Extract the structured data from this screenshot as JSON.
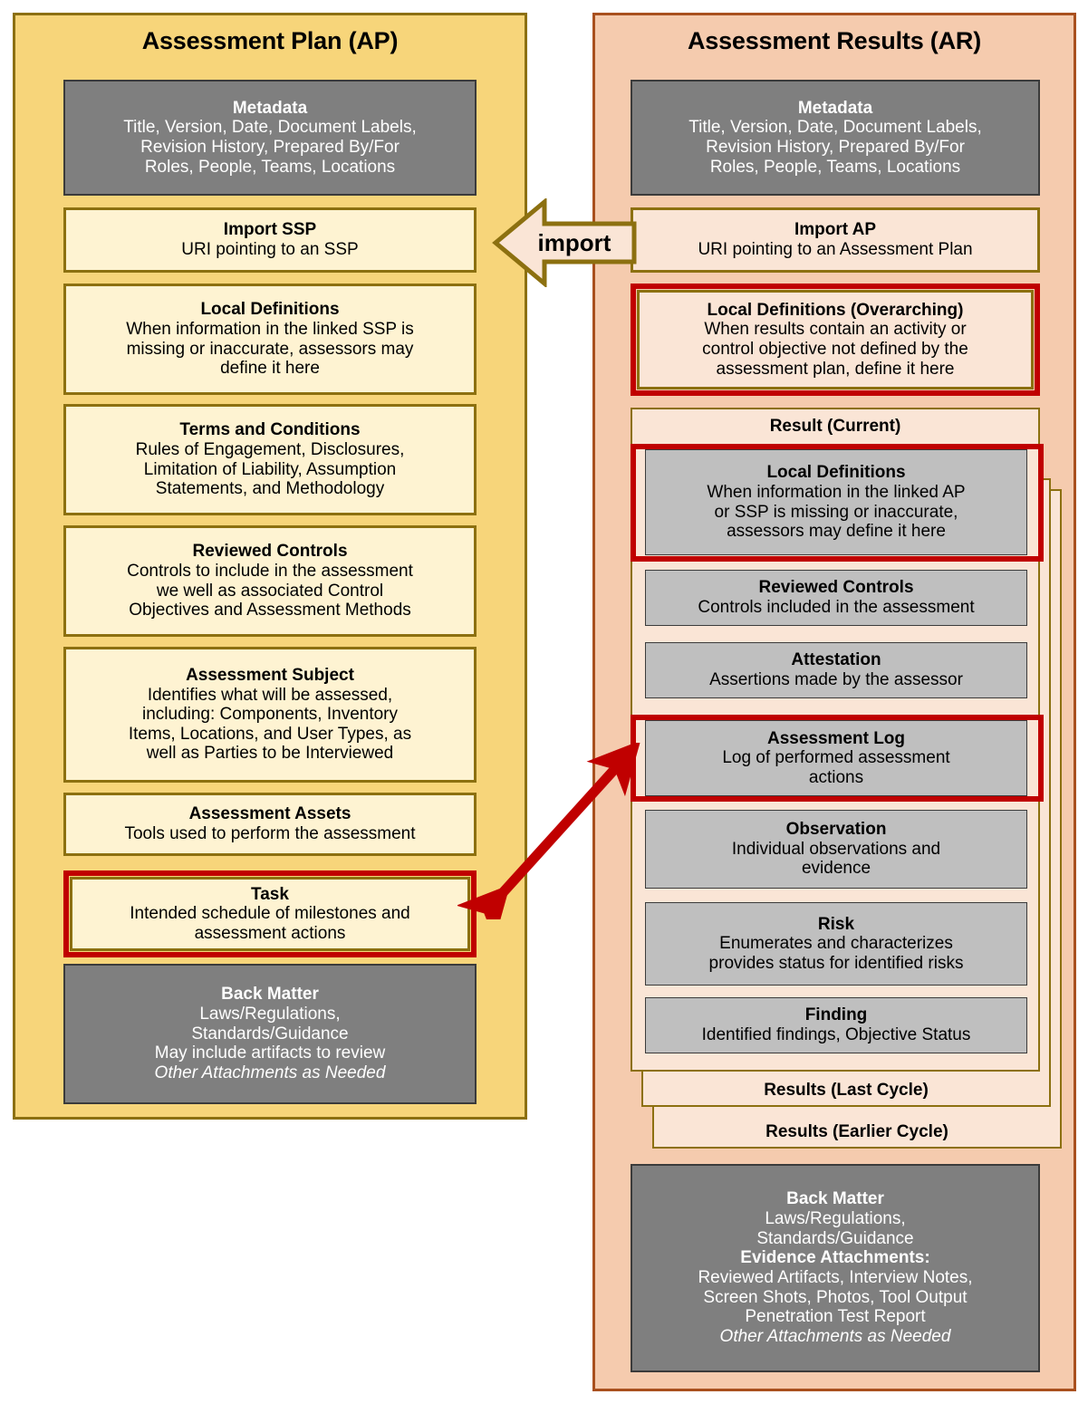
{
  "colors": {
    "ap_panel_fill": "#F7D57A",
    "ap_panel_border": "#8C7010",
    "ar_panel_fill": "#F5CBAE",
    "ar_panel_border": "#A9501E",
    "gray_box": "#7F7F7F",
    "gray_light_box": "#BFBFBF",
    "cream_box": "#FEF3D2",
    "peach_box": "#FAE5D6",
    "highlight_red": "#C00000"
  },
  "connector": {
    "import_label": "import",
    "red_double_arrow": "Task <-> Assessment Log"
  },
  "ap": {
    "title": "Assessment Plan (AP)",
    "boxes": [
      {
        "name": "metadata",
        "title": "Metadata",
        "lines": [
          "Title, Version, Date, Document Labels,",
          "Revision History, Prepared By/For",
          "Roles, People, Teams, Locations"
        ]
      },
      {
        "name": "import-ssp",
        "title": "Import SSP",
        "lines": [
          "URI pointing to an SSP"
        ]
      },
      {
        "name": "local-definitions",
        "title": "Local Definitions",
        "lines": [
          "When information in the linked SSP is",
          "missing or inaccurate, assessors may",
          "define it here"
        ]
      },
      {
        "name": "terms-and-conditions",
        "title": "Terms and Conditions",
        "lines": [
          "Rules of Engagement, Disclosures,",
          "Limitation of Liability, Assumption",
          "Statements, and Methodology"
        ]
      },
      {
        "name": "reviewed-controls",
        "title": "Reviewed Controls",
        "lines": [
          "Controls to include in the assessment",
          "we well as associated Control",
          "Objectives and Assessment Methods"
        ]
      },
      {
        "name": "assessment-subject",
        "title": "Assessment Subject",
        "lines": [
          "Identifies what will be assessed,",
          "including: Components, Inventory",
          "Items, Locations, and User Types, as",
          "well as Parties to be Interviewed"
        ]
      },
      {
        "name": "assessment-assets",
        "title": "Assessment Assets",
        "lines": [
          "Tools used to perform the assessment"
        ]
      },
      {
        "name": "task",
        "title": "Task",
        "lines": [
          "Intended schedule of milestones and",
          "assessment actions"
        ],
        "highlighted": true
      },
      {
        "name": "back-matter",
        "title": "Back Matter",
        "lines": [
          "Laws/Regulations,",
          "Standards/Guidance",
          "May include artifacts to review"
        ],
        "italic_line": "Other Attachments as Needed"
      }
    ]
  },
  "ar": {
    "title": "Assessment Results (AR)",
    "metadata": {
      "title": "Metadata",
      "lines": [
        "Title, Version, Date, Document Labels,",
        "Revision History, Prepared By/For",
        "Roles, People, Teams, Locations"
      ]
    },
    "import_ap": {
      "title": "Import AP",
      "lines": [
        "URI pointing to an Assessment Plan"
      ]
    },
    "local_definitions_overarching": {
      "title": "Local Definitions (Overarching)",
      "lines": [
        "When results contain an activity or",
        "control objective not defined by the",
        "assessment plan, define it here"
      ],
      "highlighted": true
    },
    "result_current_label": "Result (Current)",
    "results_last_cycle_label": "Results (Last Cycle)",
    "results_earlier_cycle_label": "Results (Earlier Cycle)",
    "result_boxes": [
      {
        "name": "local-definitions",
        "title": "Local Definitions",
        "lines": [
          "When information in the linked AP",
          "or SSP is missing or inaccurate,",
          "assessors may define it here"
        ],
        "highlighted": true
      },
      {
        "name": "reviewed-controls",
        "title": "Reviewed Controls",
        "lines": [
          "Controls included in the assessment"
        ]
      },
      {
        "name": "attestation",
        "title": "Attestation",
        "lines": [
          "Assertions made by the assessor"
        ]
      },
      {
        "name": "assessment-log",
        "title": "Assessment Log",
        "lines": [
          "Log of performed assessment",
          "actions"
        ],
        "highlighted": true
      },
      {
        "name": "observation",
        "title": "Observation",
        "lines": [
          "Individual observations and",
          "evidence"
        ]
      },
      {
        "name": "risk",
        "title": "Risk",
        "lines": [
          "Enumerates and characterizes",
          "provides status for identified risks"
        ]
      },
      {
        "name": "finding",
        "title": "Finding",
        "lines": [
          "Identified findings, Objective Status"
        ]
      }
    ],
    "back_matter": {
      "title": "Back Matter",
      "lines": [
        "Laws/Regulations,",
        "Standards/Guidance"
      ],
      "subhead": "Evidence Attachments:",
      "lines2": [
        "Reviewed Artifacts, Interview Notes,",
        "Screen Shots, Photos, Tool Output",
        "Penetration Test Report"
      ],
      "italic_line": "Other Attachments as Needed"
    }
  }
}
